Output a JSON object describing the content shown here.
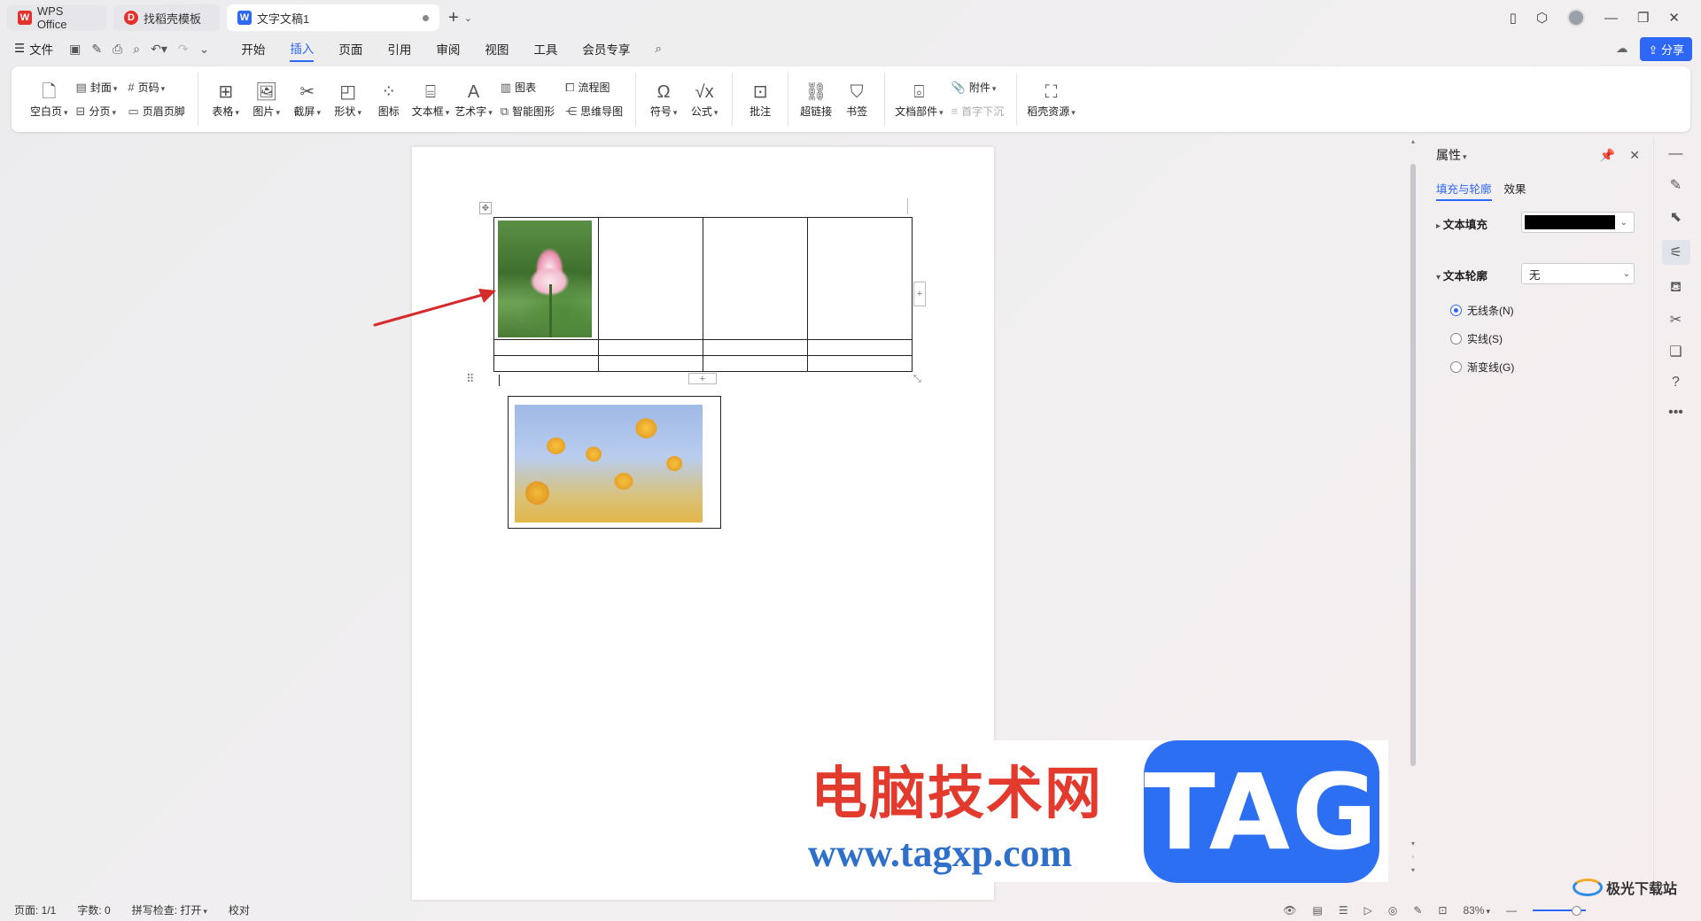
{
  "titlebar": {
    "tabs": [
      {
        "label": "WPS Office",
        "logo": "W"
      },
      {
        "label": "找稻壳模板",
        "logo": "D"
      },
      {
        "label": "文字文稿1",
        "logo": "W"
      }
    ],
    "new_tab": "+"
  },
  "menu": {
    "file": "文件",
    "tabs": [
      "开始",
      "插入",
      "页面",
      "引用",
      "审阅",
      "视图",
      "工具",
      "会员专享"
    ],
    "active_tab": "插入",
    "share": "分享"
  },
  "ribbon": {
    "blank_page": "空白页",
    "cover": "封面",
    "page_break": "分页",
    "page_number": "页码",
    "header_footer": "页眉页脚",
    "table": "表格",
    "picture": "图片",
    "screenshot": "截屏",
    "shape": "形状",
    "icon": "图标",
    "textbox": "文本框",
    "wordart": "艺术字",
    "chart": "图表",
    "smart_shape": "智能图形",
    "flowchart": "流程图",
    "mindmap": "思维导图",
    "symbol": "符号",
    "formula": "公式",
    "comment": "批注",
    "hyperlink": "超链接",
    "bookmark": "书签",
    "doc_part": "文档部件",
    "attachment": "附件",
    "drop_cap": "首字下沉",
    "resources": "稻壳资源"
  },
  "panel": {
    "title": "属性",
    "tabs": [
      "填充与轮廓",
      "效果"
    ],
    "text_fill_label": "文本填充",
    "text_fill_color": "#000000",
    "text_outline_label": "文本轮廓",
    "text_outline_value": "无",
    "options": [
      "无线条(N)",
      "实线(S)",
      "渐变线(G)"
    ],
    "selected_option": "无线条(N)"
  },
  "statusbar": {
    "page": "页面: 1/1",
    "words": "字数: 0",
    "spellcheck": "拼写检查: 打开",
    "proofread": "校对",
    "zoom": "83%"
  },
  "watermark": {
    "cn": "电脑技术网",
    "url": "www.tagxp.com",
    "tag": "TAG",
    "site": "极光下载站"
  },
  "colors": {
    "accent": "#2e67f6",
    "arrow": "#d62b2b",
    "brand_red": "#e4312b"
  }
}
